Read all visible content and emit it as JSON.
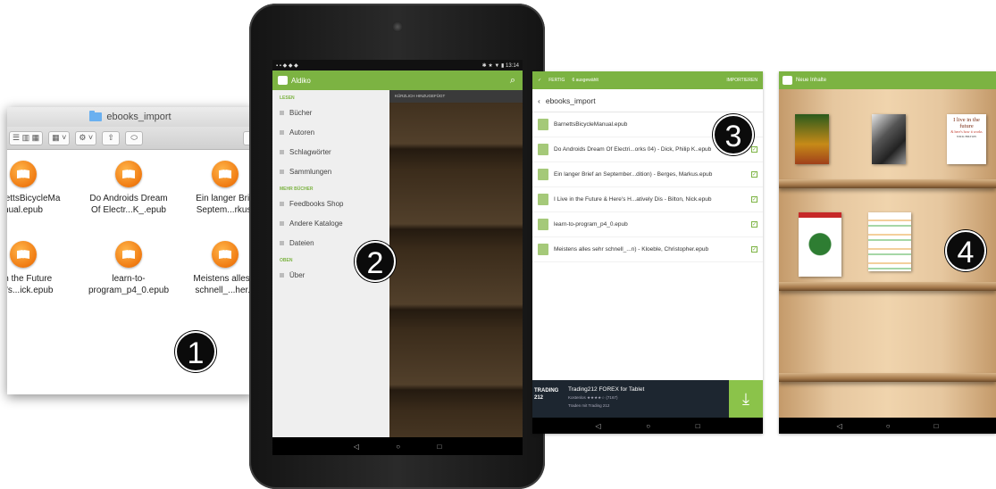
{
  "finder": {
    "title": "ebooks_import",
    "files": [
      {
        "line1": "BarnettsBicycleMa",
        "line2": "nual.epub"
      },
      {
        "line1": "Do Androids Dream",
        "line2": "Of Electr...K_.epub"
      },
      {
        "line1": "Ein langer Brie",
        "line2": "Septem...rkus."
      },
      {
        "line1": "e in the Future",
        "line2": "ere's...ick.epub"
      },
      {
        "line1": "learn-to-",
        "line2": "program_p4_0.epub"
      },
      {
        "line1": "Meistens alles s",
        "line2": "schnell_...her.e"
      }
    ]
  },
  "badges": [
    "1",
    "2",
    "3",
    "4"
  ],
  "aldiko": {
    "status_time": "13:14",
    "app_title": "Aldiko",
    "sections": {
      "library": "LESEN",
      "more": "MEHR BÜCHER",
      "other": "OBEN"
    },
    "library_items": [
      "Bücher",
      "Autoren",
      "Schlagwörter",
      "Sammlungen"
    ],
    "more_items": [
      "Feedbooks Shop",
      "Andere Kataloge",
      "Dateien"
    ],
    "other_items": [
      "Über"
    ],
    "recent_header": "KÜRZLICH HINZUGEFÜGT"
  },
  "import_screen": {
    "done_label": "FERTIG",
    "selected_label": "6 ausgewählt",
    "import_label": "IMPORTIEREN",
    "folder": "ebooks_import",
    "files": [
      {
        "name": "BarnettsBicycleManual.epub",
        "checked": false
      },
      {
        "name": "Do Androids Dream Of Electri...orks 04) - Dick, Philip K..epub",
        "checked": true
      },
      {
        "name": "Ein langer Brief an September...dition) - Berges, Markus.epub",
        "checked": true
      },
      {
        "name": "I Live in the Future & Here's H...atively Dis - Bilton, Nick.epub",
        "checked": true
      },
      {
        "name": "learn-to-program_p4_0.epub",
        "checked": true
      },
      {
        "name": "Meistens alles sehr schnell_...n) - Kloeble, Christopher.epub",
        "checked": true
      }
    ],
    "ad": {
      "logo_top": "TRADING",
      "logo_bottom": "212",
      "title": "Trading212 FOREX for Tablet",
      "subtitle": "Kostenlos ★★★★☆ (7167)",
      "note": "Traden mit Trading 212"
    }
  },
  "bookshelf": {
    "title": "Neue Inhalte",
    "cover_text": {
      "future_title": "I live in the future",
      "future_sub": "& here's how it works",
      "future_author": "NICK BILTON"
    }
  },
  "colors": {
    "accent": "#7cb342",
    "badge": "#0b0b0b"
  },
  "icons": {
    "nav_back": "◁",
    "nav_home": "○",
    "nav_recent": "□",
    "search": "⌕",
    "checkmark": "✓",
    "download": "⤓"
  }
}
